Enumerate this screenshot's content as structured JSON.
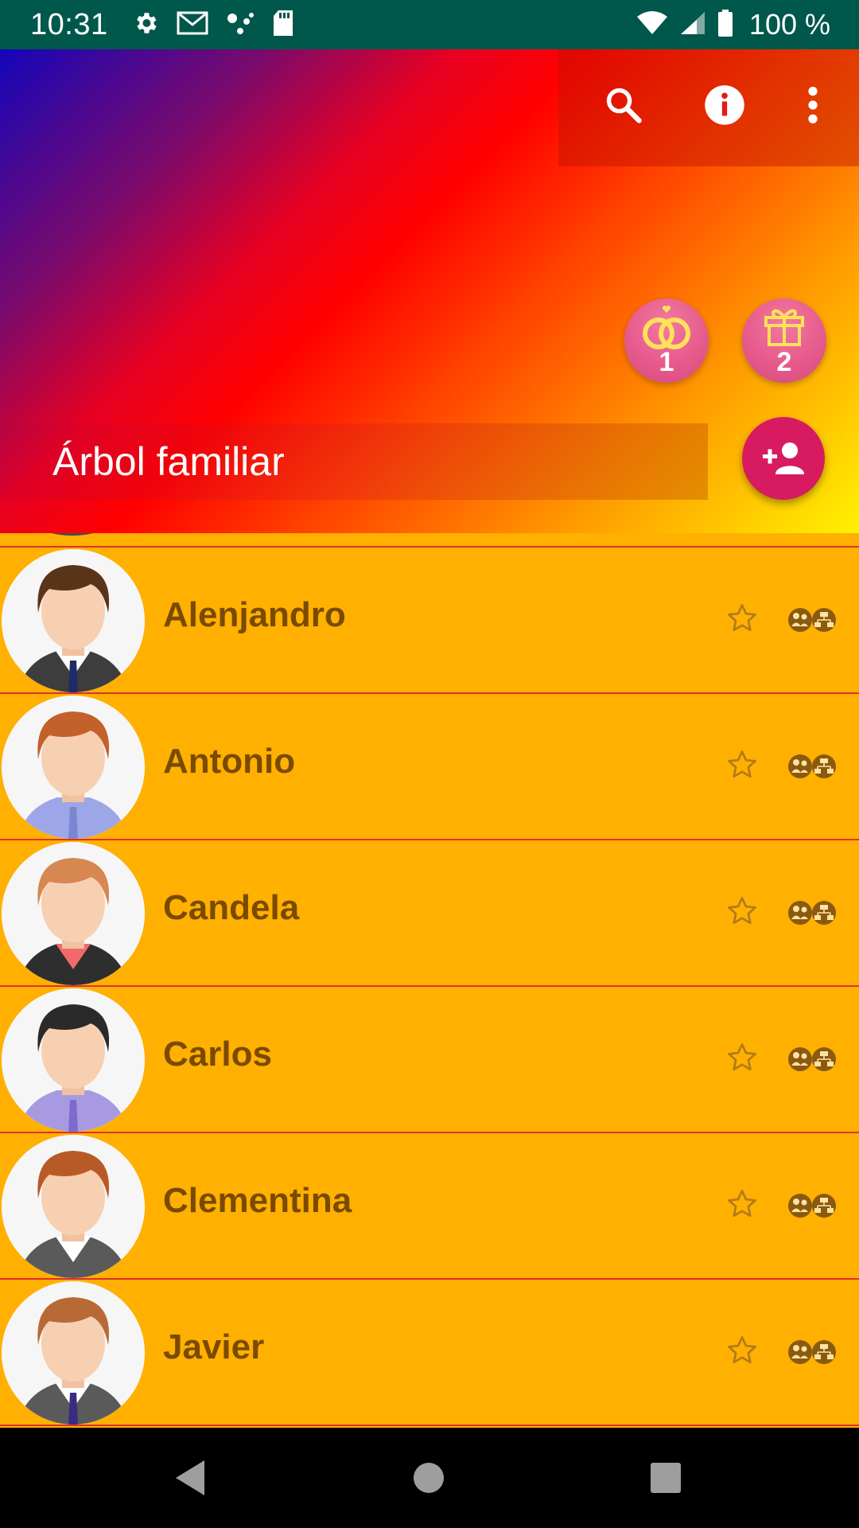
{
  "status_bar": {
    "time": "10:31",
    "battery_text": "100 %",
    "left_icons": [
      "settings-icon",
      "gmail-icon",
      "dots-icon",
      "sd-card-icon"
    ],
    "right_icons": [
      "wifi-icon",
      "signal-icon",
      "battery-icon"
    ]
  },
  "header": {
    "title": "Árbol familiar",
    "actions": [
      "search-icon",
      "info-icon",
      "more-vert-icon"
    ],
    "chips": [
      {
        "icon": "rings-icon",
        "count": "1"
      },
      {
        "icon": "gift-icon",
        "count": "2"
      }
    ],
    "fab_icon": "add-person-icon"
  },
  "people": [
    {
      "name": "Alenjandro",
      "hair": "#5A3418",
      "shirt": "#FFFFFF",
      "jacket": "#3D3D3D",
      "tie": "#1F2B66"
    },
    {
      "name": "Antonio",
      "hair": "#C2612A",
      "shirt": "#9DA6E6",
      "jacket": "#9DA6E6",
      "tie": "#7A86D0"
    },
    {
      "name": "Candela",
      "hair": "#D68850",
      "shirt": "#F06A6A",
      "jacket": "#2E2E2E",
      "tie": ""
    },
    {
      "name": "Carlos",
      "hair": "#2A2A2A",
      "shirt": "#A89AE0",
      "jacket": "#A89AE0",
      "tie": "#7E6BD0"
    },
    {
      "name": "Clementina",
      "hair": "#B85A28",
      "shirt": "#FFFFFF",
      "jacket": "#5A5A5A",
      "tie": ""
    },
    {
      "name": "Javier",
      "hair": "#B86A36",
      "shirt": "#FFFFFF",
      "jacket": "#5A5A5A",
      "tie": "#3A2A80"
    }
  ],
  "colors": {
    "list_background": "#FFB000",
    "name_text": "#7A4A00",
    "separator": "#E0312A",
    "fab": "#D81B60",
    "status_bar": "#00574B"
  },
  "nav_bar": [
    "back-icon",
    "home-icon",
    "recents-icon"
  ]
}
